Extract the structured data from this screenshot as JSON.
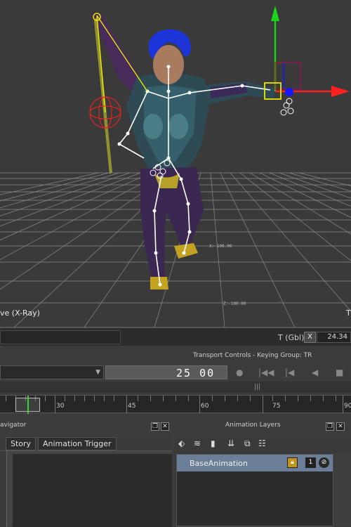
{
  "viewport": {
    "left_label": "ve (X-Ray)",
    "right_label": "T",
    "grid_labels": [
      "X:-100.00",
      "Z:-100.00"
    ]
  },
  "infobar": {
    "t_label": "T (Gbl)",
    "axis_button": "X",
    "axis_value": "24.34"
  },
  "transport": {
    "title": "Transport Controls  -  Keying Group: TR",
    "frame": "25 00"
  },
  "timeline": {
    "labels": [
      "30",
      "45",
      "60",
      "75",
      "90"
    ]
  },
  "navigator": {
    "title": "avigator",
    "tabs": [
      "Story",
      "Animation Trigger"
    ]
  },
  "layers": {
    "title": "Animation Layers",
    "rows": [
      {
        "name": "BaseAnimation",
        "badge": "1"
      }
    ]
  },
  "colors": {
    "viewport_bg": "#3a3a3a",
    "layer_selected": "#6a7f97",
    "gizmo_x": "#ff2020",
    "gizmo_y": "#18d818",
    "gizmo_z": "#1818ff",
    "timeline_cursor": "#3fcf3f"
  }
}
